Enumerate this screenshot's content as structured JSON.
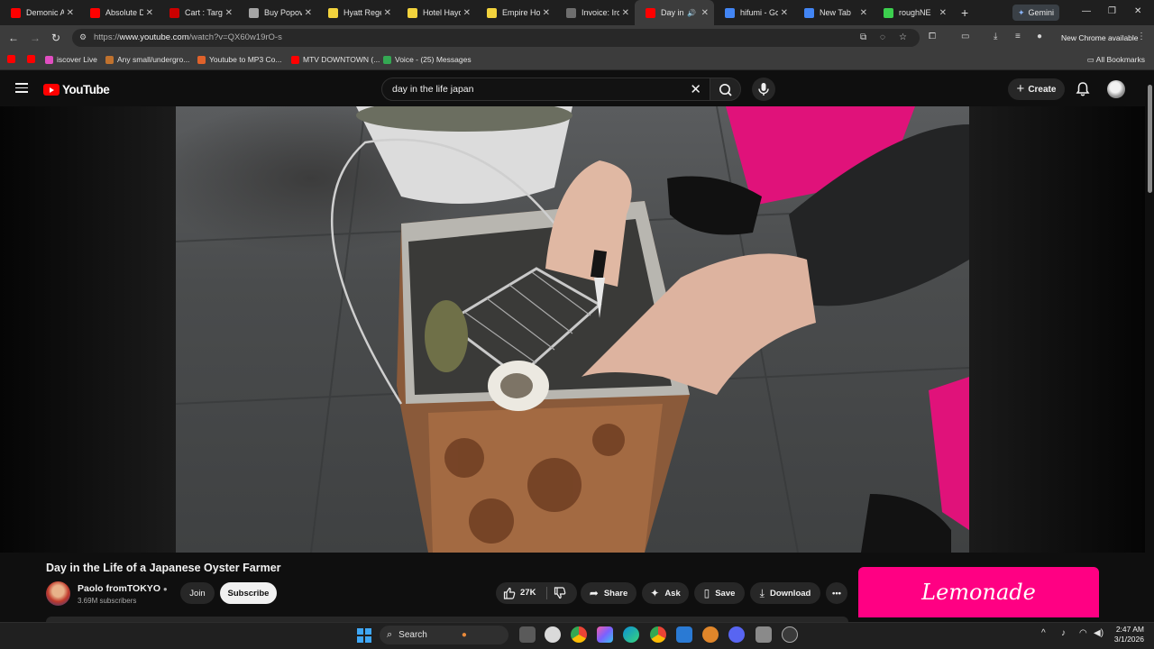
{
  "browser": {
    "tabs": [
      {
        "title": "Demonic A",
        "fav_color": "#ff0000"
      },
      {
        "title": "Absolute D",
        "fav_color": "#ff0000"
      },
      {
        "title": "Cart : Targe",
        "fav_color": "#cc0000"
      },
      {
        "title": "Buy Popov",
        "fav_color": "#a5a5a5"
      },
      {
        "title": "Hyatt Rege",
        "fav_color": "#f2d33d"
      },
      {
        "title": "Hotel Hayd",
        "fav_color": "#f2d33d"
      },
      {
        "title": "Empire Hot",
        "fav_color": "#f2d33d"
      },
      {
        "title": "Invoice: Iro",
        "fav_color": "#6e6e6e"
      },
      {
        "title": "Day in",
        "fav_color": "#ff0000"
      },
      {
        "title": "hifumi - Go",
        "fav_color": "#4285f4"
      },
      {
        "title": "New Tab",
        "fav_color": "#4285f4"
      },
      {
        "title": "roughNE",
        "fav_color": "#3ccf4e"
      }
    ],
    "gemini_label": "Gemini",
    "url_prefix": "https://",
    "url_host": "www.youtube.com",
    "url_path": "/watch?v=QX60w19rO-s",
    "update_label": "New Chrome available",
    "bookmarks": [
      {
        "label": "",
        "fav_color": "#ff0000"
      },
      {
        "label": "",
        "fav_color": "#ff0000"
      },
      {
        "label": "iscover Live",
        "fav_color": "#e14ec1"
      },
      {
        "label": "Any small/undergro...",
        "fav_color": "#c0722e"
      },
      {
        "label": "Youtube to MP3 Co...",
        "fav_color": "#e0622b"
      },
      {
        "label": "MTV DOWNTOWN (...",
        "fav_color": "#ff0000"
      },
      {
        "label": "Voice - (25) Messages",
        "fav_color": "#34a853"
      }
    ],
    "all_bookmarks_label": "All Bookmarks"
  },
  "youtube": {
    "logo_text": "YouTube",
    "search_query": "day in the life japan",
    "create_label": "Create",
    "video": {
      "title": "Day in the Life of a Japanese Oyster Farmer",
      "channel": "Paolo fromTOKYO",
      "subscribers": "3.69M subscribers",
      "join_label": "Join",
      "subscribe_label": "Subscribe",
      "like_count": "27K",
      "share_label": "Share",
      "ask_label": "Ask",
      "save_label": "Save",
      "download_label": "Download"
    },
    "ad_text": "Lemonade"
  },
  "taskbar": {
    "search_label": "Search",
    "time": "2:47 AM",
    "date": "3/1/2026"
  },
  "colors": {
    "accent_red": "#ff0000",
    "ad_pink": "#ff0083",
    "page_bg": "#0f0f0f"
  }
}
